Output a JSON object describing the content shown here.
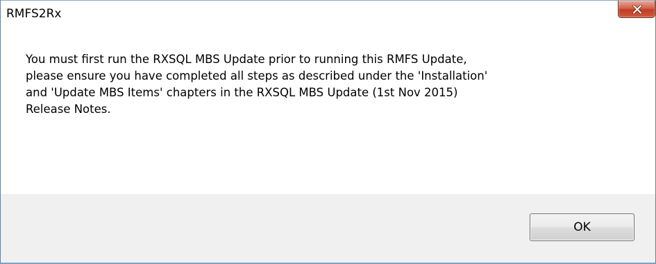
{
  "window": {
    "title": "RMFS2Rx",
    "close_icon": "close-icon"
  },
  "message": {
    "text": "You must first run the RXSQL MBS Update prior to running this RMFS Update,\nplease ensure you have completed all steps as described under the 'Installation'\nand 'Update MBS Items' chapters in the RXSQL MBS Update (1st Nov 2015)\nRelease Notes."
  },
  "buttons": {
    "ok_label": "OK"
  },
  "colors": {
    "close_button": "#c8452c",
    "footer_background": "#f0f0f0",
    "frame_border": "#7ea0c4"
  }
}
